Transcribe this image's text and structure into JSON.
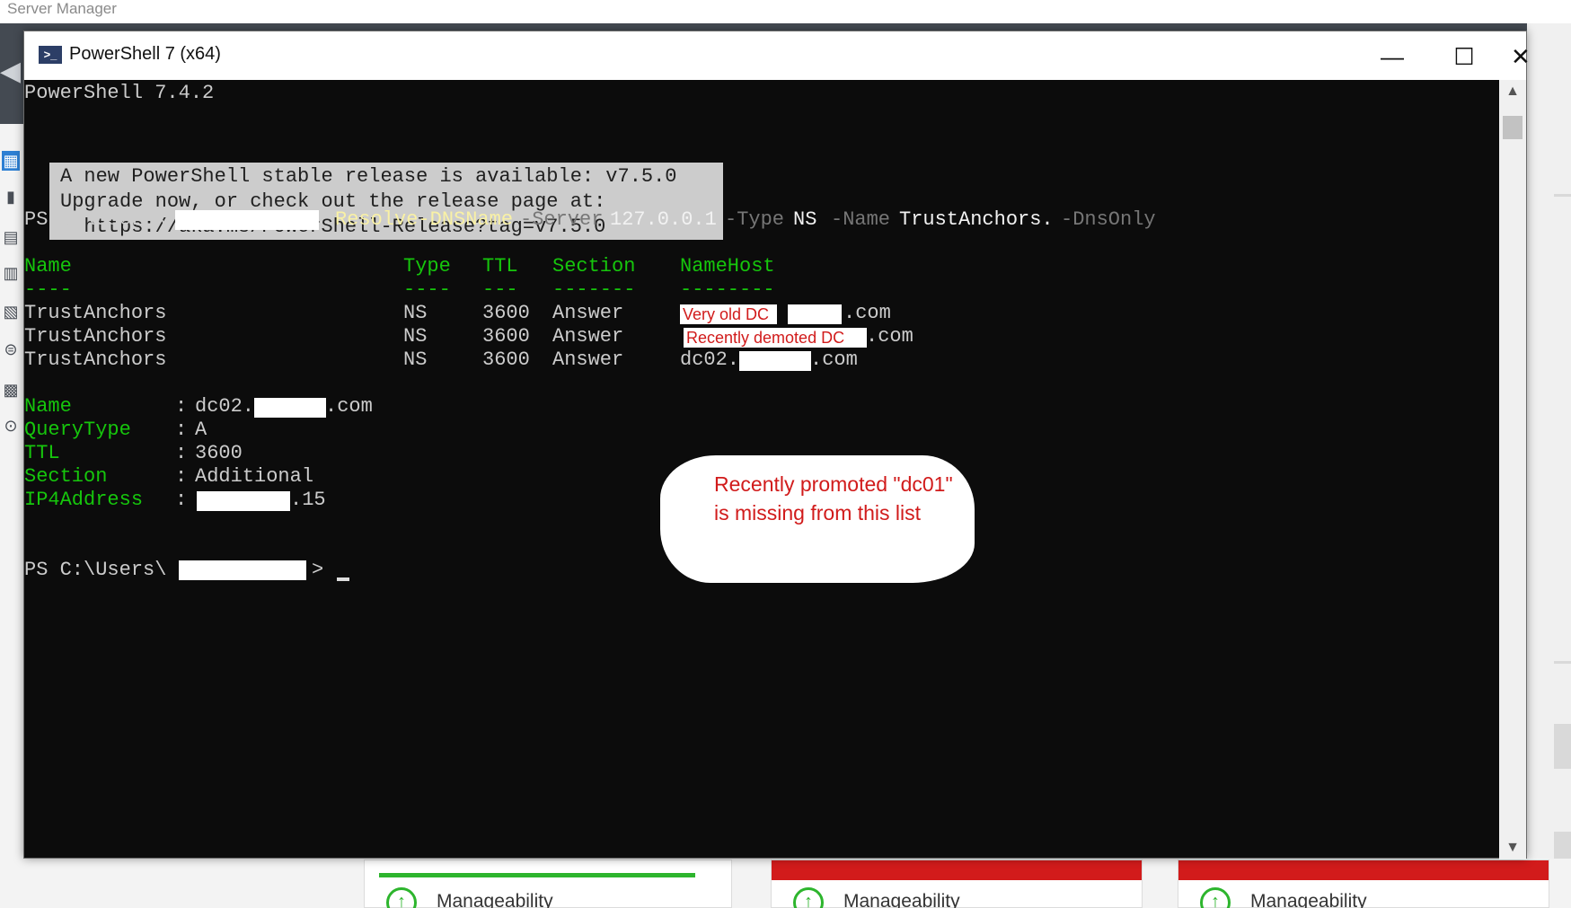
{
  "background_app": {
    "title": "Server Manager",
    "tile_label": "Manageability"
  },
  "window": {
    "title": "PowerShell 7 (x64)",
    "controls": {
      "minimize": "—",
      "maximize": "☐",
      "close": "✕"
    }
  },
  "console": {
    "version_line": "PowerShell 7.4.2",
    "notice": [
      "A new PowerShell stable release is available: v7.5.0",
      "Upgrade now, or check out the release page at:",
      "  https://aka.ms/PowerShell-Release?tag=v7.5.0"
    ],
    "prompt_prefix": "PS C:\\Users\\",
    "command": {
      "cmdlet": "Resolve-DNSName",
      "server_param": "-Server",
      "server_value": "127.0.0.1",
      "type_param": "-Type",
      "type_value": "NS",
      "name_param": "-Name",
      "name_value": "TrustAnchors.",
      "dnsonly_param": "-DnsOnly"
    },
    "table": {
      "headers": [
        "Name",
        "Type",
        "TTL",
        "Section",
        "NameHost"
      ],
      "dashes": [
        "----",
        "----",
        "---",
        "-------",
        "--------"
      ],
      "rows": [
        {
          "name": "TrustAnchors",
          "type": "NS",
          "ttl": "3600",
          "section": "Answer",
          "namehost_suffix": ".com",
          "annotation": "Very old DC"
        },
        {
          "name": "TrustAnchors",
          "type": "NS",
          "ttl": "3600",
          "section": "Answer",
          "namehost_suffix": ".com",
          "annotation": "Recently demoted DC"
        },
        {
          "name": "TrustAnchors",
          "type": "NS",
          "ttl": "3600",
          "section": "Answer",
          "namehost_prefix": "dc02.",
          "namehost_suffix": ".com"
        }
      ]
    },
    "additional": [
      {
        "key": "Name",
        "value_prefix": "dc02.",
        "value_suffix": ".com"
      },
      {
        "key": "QueryType",
        "value": "A"
      },
      {
        "key": "TTL",
        "value": "3600"
      },
      {
        "key": "Section",
        "value": "Additional"
      },
      {
        "key": "IP4Address",
        "value_suffix": ".15"
      }
    ],
    "final_prompt_suffix": ">",
    "callout": "Recently promoted \"dc01\" is missing from this list"
  },
  "colors": {
    "console_bg": "#0c0c0c",
    "console_text": "#cccccc",
    "header_green": "#16c60c",
    "cmdlet_yellow": "#f9f1a5",
    "param_gray": "#767676",
    "annotation_red": "#d11b1b"
  }
}
